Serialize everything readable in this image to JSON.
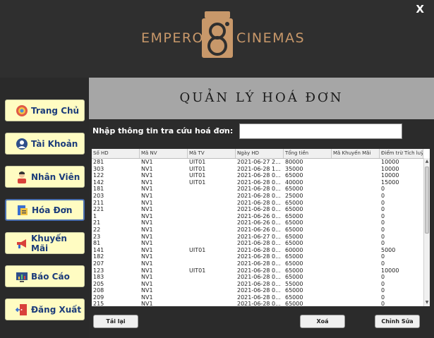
{
  "window": {
    "close_label": "X"
  },
  "logo": {
    "left": "EMPEROR",
    "right": "CINEMAS"
  },
  "sidebar": {
    "items": [
      {
        "label": "Trang Chủ",
        "icon": "home-wheel-icon"
      },
      {
        "label": "Tài Khoản",
        "icon": "user-account-icon"
      },
      {
        "label": "Nhân Viên",
        "icon": "employee-icon"
      },
      {
        "label": "Hóa Đơn",
        "icon": "invoice-icon",
        "active": true
      },
      {
        "label": "Khuyến Mãi",
        "icon": "megaphone-icon"
      },
      {
        "label": "Báo Cáo",
        "icon": "report-chart-icon"
      },
      {
        "label": "Đăng Xuất",
        "icon": "logout-door-icon"
      }
    ]
  },
  "main": {
    "title": "QUẢN LÝ HOÁ ĐƠN",
    "search_label": "Nhập thông tin tra cứu hoá đơn:",
    "search_value": ""
  },
  "table": {
    "columns": [
      "Số HD",
      "Mã NV",
      "Mã TV",
      "Ngày HD",
      "Tổng tiền",
      "Mã Khuyến Mãi",
      "Điểm trừ Tích luỹ"
    ],
    "rows": [
      [
        "281",
        "NV1",
        "UIT01",
        "2021-06-27 2...",
        "80000",
        "",
        "10000"
      ],
      [
        "303",
        "NV1",
        "UIT01",
        "2021-06-28 1...",
        "35000",
        "",
        "10000"
      ],
      [
        "122",
        "NV1",
        "UIT01",
        "2021-06-28 0...",
        "65000",
        "",
        "10000"
      ],
      [
        "142",
        "NV1",
        "UIT01",
        "2021-06-28 0...",
        "40000",
        "",
        "15000"
      ],
      [
        "181",
        "NV1",
        "",
        "2021-06-28 0...",
        "65000",
        "",
        "0"
      ],
      [
        "203",
        "NV1",
        "",
        "2021-06-28 0...",
        "25000",
        "",
        "0"
      ],
      [
        "211",
        "NV1",
        "",
        "2021-06-28 0...",
        "65000",
        "",
        "0"
      ],
      [
        "221",
        "NV1",
        "",
        "2021-06-28 0...",
        "65000",
        "",
        "0"
      ],
      [
        "1",
        "NV1",
        "",
        "2021-06-26 0...",
        "65000",
        "",
        "0"
      ],
      [
        "21",
        "NV1",
        "",
        "2021-06-26 0...",
        "65000",
        "",
        "0"
      ],
      [
        "22",
        "NV1",
        "",
        "2021-06-26 0...",
        "65000",
        "",
        "0"
      ],
      [
        "23",
        "NV1",
        "",
        "2021-06-27 0...",
        "65000",
        "",
        "0"
      ],
      [
        "81",
        "NV1",
        "",
        "2021-06-28 0...",
        "65000",
        "",
        "0"
      ],
      [
        "141",
        "NV1",
        "UIT01",
        "2021-06-28 0...",
        "60000",
        "",
        "5000"
      ],
      [
        "182",
        "NV1",
        "",
        "2021-06-28 0...",
        "65000",
        "",
        "0"
      ],
      [
        "207",
        "NV1",
        "",
        "2021-06-28 0...",
        "65000",
        "",
        "0"
      ],
      [
        "123",
        "NV1",
        "UIT01",
        "2021-06-28 0...",
        "65000",
        "",
        "10000"
      ],
      [
        "183",
        "NV1",
        "",
        "2021-06-28 0...",
        "65000",
        "",
        "0"
      ],
      [
        "205",
        "NV1",
        "",
        "2021-06-28 0...",
        "55000",
        "",
        "0"
      ],
      [
        "208",
        "NV1",
        "",
        "2021-06-28 0...",
        "65000",
        "",
        "0"
      ],
      [
        "209",
        "NV1",
        "",
        "2021-06-28 0...",
        "65000",
        "",
        "0"
      ],
      [
        "215",
        "NV1",
        "",
        "2021-06-28 0...",
        "65000",
        "",
        "0"
      ]
    ]
  },
  "buttons": {
    "reload": "Tải lại",
    "delete": "Xoá",
    "edit": "Chỉnh Sửa"
  },
  "colors": {
    "accent_gold": "#c8986a",
    "nav_button": "#fffcc2",
    "nav_text": "#1c3c7a"
  }
}
